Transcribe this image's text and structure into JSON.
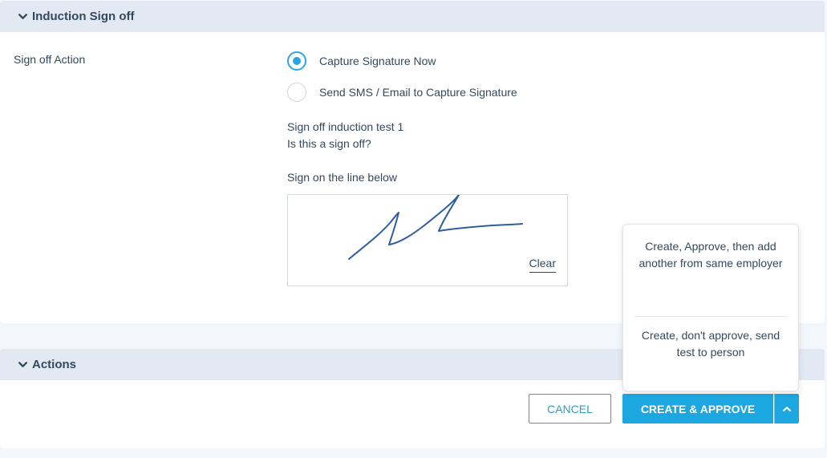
{
  "sections": {
    "induction": {
      "title": "Induction Sign off"
    },
    "actions": {
      "title": "Actions"
    }
  },
  "sign_off": {
    "label": "Sign off Action",
    "options": [
      {
        "label": "Capture Signature Now",
        "selected": true
      },
      {
        "label": "Send SMS / Email to Capture Signature",
        "selected": false
      }
    ],
    "title": "Sign off induction test 1",
    "question": "Is this a sign off?",
    "instruction": "Sign on the line below",
    "clear_label": "Clear"
  },
  "buttons": {
    "cancel": "CANCEL",
    "create_approve": "CREATE & APPROVE"
  },
  "dropdown": {
    "items": [
      "Create, Approve, then add another from same employer",
      "Create, don't approve, send test to person"
    ]
  },
  "colors": {
    "accent": "#1ca7e0",
    "signature_ink": "#2f5e9a",
    "header_bg": "#e3e9f2"
  },
  "icons": {
    "section_toggle": "chevron-down-icon",
    "split_toggle": "chevron-up-icon"
  }
}
